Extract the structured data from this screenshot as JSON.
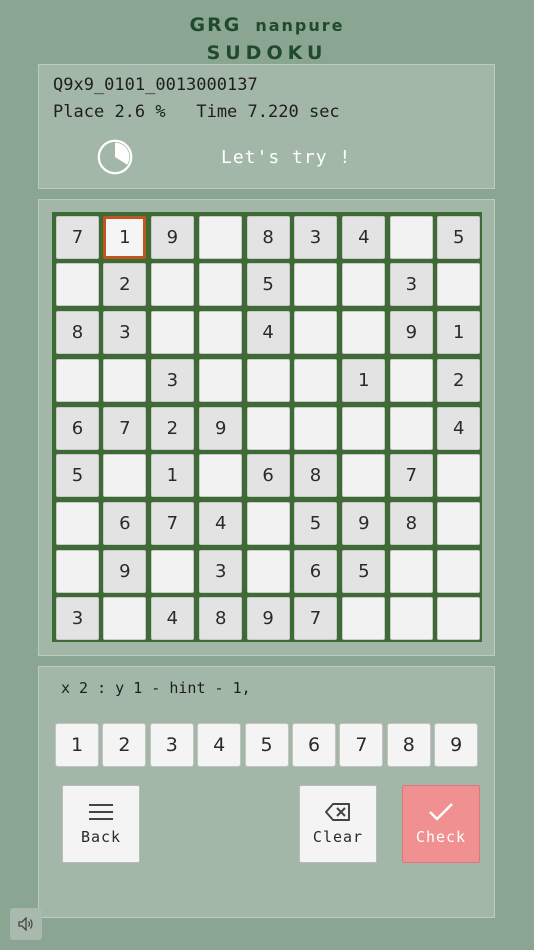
{
  "header": {
    "logo_line1_a": "GRG",
    "logo_line1_b": "nanpure",
    "logo_line2": "SUDOKU"
  },
  "info": {
    "puzzle_id": "Q9x9_0101_0013000137",
    "place_label": "Place",
    "place_value": "2.6 %",
    "time_label": "Time",
    "time_value": "7.220 sec",
    "message": "Let's try !"
  },
  "board": {
    "selected": {
      "row": 0,
      "col": 1
    },
    "rows": [
      [
        "7",
        "1",
        "9",
        "",
        "8",
        "3",
        "4",
        "",
        "5"
      ],
      [
        "",
        "2",
        "",
        "",
        "5",
        "",
        "",
        "3",
        ""
      ],
      [
        "8",
        "3",
        "",
        "",
        "4",
        "",
        "",
        "9",
        "1"
      ],
      [
        "",
        "",
        "3",
        "",
        "",
        "",
        "1",
        "",
        "2"
      ],
      [
        "6",
        "7",
        "2",
        "9",
        "",
        "",
        "",
        "",
        "4"
      ],
      [
        "5",
        "",
        "1",
        "",
        "6",
        "8",
        "",
        "7",
        ""
      ],
      [
        "",
        "6",
        "7",
        "4",
        "",
        "5",
        "9",
        "8",
        ""
      ],
      [
        "",
        "9",
        "",
        "3",
        "",
        "6",
        "5",
        "",
        ""
      ],
      [
        "3",
        "",
        "4",
        "8",
        "9",
        "7",
        "",
        "",
        ""
      ]
    ]
  },
  "control": {
    "hint_text": "x 2 : y 1 - hint - 1,",
    "number_buttons": [
      "1",
      "2",
      "3",
      "4",
      "5",
      "6",
      "7",
      "8",
      "9"
    ],
    "back_label": "Back",
    "clear_label": "Clear",
    "check_label": "Check"
  },
  "colors": {
    "background": "#8aa591",
    "board_frame": "#3e6a35",
    "selection": "#c0561f",
    "check_button": "#f09091"
  },
  "icons": {
    "timer": "pie-timer-icon",
    "back": "menu-icon",
    "clear": "backspace-icon",
    "check": "checkmark-icon",
    "sound": "speaker-icon"
  }
}
